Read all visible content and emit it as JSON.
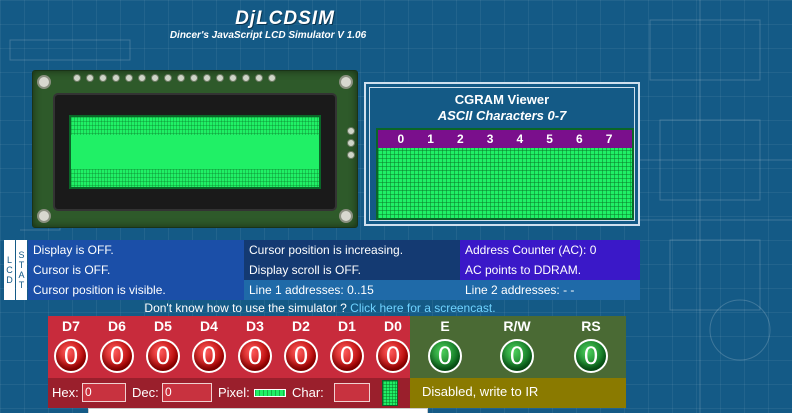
{
  "header": {
    "title": "DjLCDSIM",
    "subtitle": "Dincer's JavaScript LCD Simulator V 1.06"
  },
  "cgram": {
    "title": "CGRAM Viewer",
    "subtitle": "ASCII Characters 0-7",
    "indices": [
      "0",
      "1",
      "2",
      "3",
      "4",
      "5",
      "6",
      "7"
    ]
  },
  "lcd_stat": {
    "side_label_left": "LCD",
    "side_label_right": "STAT"
  },
  "status": {
    "rows": [
      [
        "Display is OFF.",
        "Cursor position is increasing.",
        "Address Counter (AC): 0"
      ],
      [
        "Cursor is OFF.",
        "Display scroll is OFF.",
        "AC points to DDRAM."
      ],
      [
        "Cursor position is visible.",
        "Line 1 addresses: 0..15",
        "Line 2 addresses: - -"
      ]
    ],
    "colors": {
      "col1": [
        "#1b4fa8",
        "#1b4fa8",
        "#1b4fa8"
      ],
      "col2": [
        "#143a72",
        "#143a72",
        "#1f6aa8"
      ],
      "col3": [
        "#3a18c8",
        "#3a18c8",
        "#1f6aa8"
      ]
    }
  },
  "help": {
    "text": "Don't know how to use the simulator ?",
    "link": "Click here for a screencast."
  },
  "data_bits": [
    {
      "label": "D7",
      "value": "0"
    },
    {
      "label": "D6",
      "value": "0"
    },
    {
      "label": "D5",
      "value": "0"
    },
    {
      "label": "D4",
      "value": "0"
    },
    {
      "label": "D3",
      "value": "0"
    },
    {
      "label": "D2",
      "value": "0"
    },
    {
      "label": "D1",
      "value": "0"
    },
    {
      "label": "D0",
      "value": "0"
    }
  ],
  "control_bits": [
    {
      "label": "E",
      "value": "0"
    },
    {
      "label": "R/W",
      "value": "0"
    },
    {
      "label": "RS",
      "value": "0"
    }
  ],
  "bottom": {
    "hex_label": "Hex:",
    "hex_value": "0",
    "dec_label": "Dec:",
    "dec_value": "0",
    "pixel_label": "Pixel:",
    "char_label": "Char:",
    "char_value": "",
    "ir_status": "Disabled, write to IR"
  }
}
